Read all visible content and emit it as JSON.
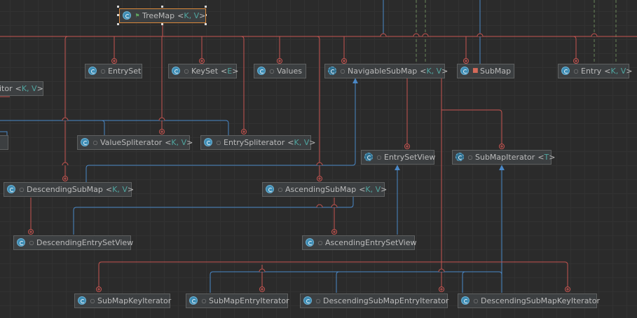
{
  "nodes": [
    {
      "id": "treemap",
      "name": "TreeMap",
      "typeParams": "K, V",
      "icon": "class",
      "visibility": "public",
      "selected": true
    },
    {
      "id": "entryset",
      "name": "EntrySet",
      "typeParams": "",
      "icon": "class",
      "visibility": "package"
    },
    {
      "id": "keyset",
      "name": "KeySet",
      "typeParams": "E",
      "icon": "class",
      "visibility": "package"
    },
    {
      "id": "values",
      "name": "Values",
      "typeParams": "",
      "icon": "class",
      "visibility": "package"
    },
    {
      "id": "navsubmap",
      "name": "NavigableSubMap",
      "typeParams": "K, V",
      "icon": "abstract",
      "visibility": "package"
    },
    {
      "id": "submap",
      "name": "SubMap",
      "typeParams": "",
      "icon": "class",
      "visibility": "private"
    },
    {
      "id": "entry",
      "name": "Entry",
      "typeParams": "K, V",
      "icon": "class",
      "visibility": "package"
    },
    {
      "id": "iterator_cut",
      "name": "itor",
      "typeParams": "K, V",
      "icon": "none",
      "visibility": "none"
    },
    {
      "id": "cut2",
      "name": "",
      "typeParams": "",
      "icon": "none",
      "visibility": "none"
    },
    {
      "id": "valuespliterator",
      "name": "ValueSpliterator",
      "typeParams": "K, V",
      "icon": "class",
      "visibility": "package"
    },
    {
      "id": "entryspliterator",
      "name": "EntrySpliterator",
      "typeParams": "K, V",
      "icon": "class",
      "visibility": "package"
    },
    {
      "id": "entrysetview",
      "name": "EntrySetView",
      "typeParams": "",
      "icon": "abstract",
      "visibility": "package"
    },
    {
      "id": "submapiterator",
      "name": "SubMapIterator",
      "typeParams": "T",
      "icon": "abstract",
      "visibility": "package"
    },
    {
      "id": "descsubmap",
      "name": "DescendingSubMap",
      "typeParams": "K, V",
      "icon": "class",
      "visibility": "package"
    },
    {
      "id": "ascsubmap",
      "name": "AscendingSubMap",
      "typeParams": "K, V",
      "icon": "class",
      "visibility": "package"
    },
    {
      "id": "descentrysetview",
      "name": "DescendingEntrySetView",
      "typeParams": "",
      "icon": "class",
      "visibility": "package"
    },
    {
      "id": "ascentrysetview",
      "name": "AscendingEntrySetView",
      "typeParams": "",
      "icon": "class",
      "visibility": "package"
    },
    {
      "id": "submapkeyiterator",
      "name": "SubMapKeyIterator",
      "typeParams": "",
      "icon": "class",
      "visibility": "package"
    },
    {
      "id": "submapentryiterator",
      "name": "SubMapEntryIterator",
      "typeParams": "",
      "icon": "class",
      "visibility": "package"
    },
    {
      "id": "descsubmapentryiterator",
      "name": "DescendingSubMapEntryIterator",
      "typeParams": "",
      "icon": "class",
      "visibility": "package"
    },
    {
      "id": "descsubmapkeyiterator",
      "name": "DescendingSubMapKeyIterator",
      "typeParams": "",
      "icon": "class",
      "visibility": "package"
    }
  ],
  "colors": {
    "background": "#2b2b2b",
    "innerEdge": "#c75450",
    "inheritEdge": "#4a88c7",
    "dependencyEdge": "#6a8759",
    "selectionBorder": "#d9873a",
    "typeParam": "#50a6a0"
  }
}
